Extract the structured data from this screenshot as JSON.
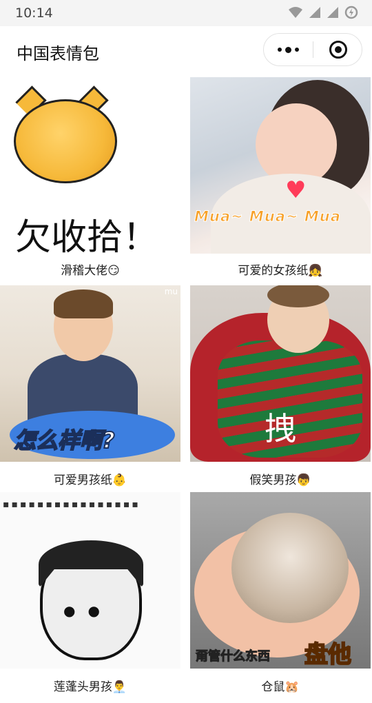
{
  "status_bar": {
    "time": "10:14"
  },
  "nav": {
    "title": "中国表情包"
  },
  "items": [
    {
      "caption": "滑稽大佬😏",
      "overlay": "欠收拾！"
    },
    {
      "caption": "可爱的女孩纸👧",
      "overlay": "Mua~ Mua~ Mua"
    },
    {
      "caption": "可爱男孩纸👶",
      "overlay": "怎么样啊?",
      "watermark": "mu"
    },
    {
      "caption": "假笑男孩👦",
      "overlay": "拽"
    },
    {
      "caption": "莲蓬头男孩👨‍💼",
      "overlay": "▪▪▪▪▪▪▪▪▪▪▪▪▪▪▪▪"
    },
    {
      "caption": "仓鼠🐹",
      "overlay": "甭管什么东西",
      "overlay2": "盘他"
    }
  ]
}
